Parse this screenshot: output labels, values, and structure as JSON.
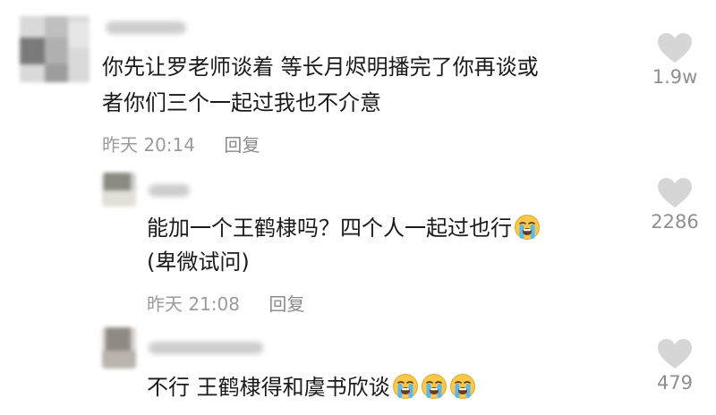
{
  "comments": [
    {
      "lines": [
        "你先让罗老师谈着 等长月烬明播完了你再谈或",
        "者你们三个一起过我也不介意"
      ],
      "time": "昨天 20:14",
      "reply": "回复",
      "likes": "1.9w"
    },
    {
      "lines": [
        "能加一个王鹤棣吗？四个人一起过也行",
        "(卑微试问)"
      ],
      "time": "昨天 21:08",
      "reply": "回复",
      "likes": "2286",
      "emoji": "loudly-crying-face"
    },
    {
      "lines": [
        "不行 王鹤棣得和虞书欣谈"
      ],
      "likes": "479",
      "emoji": "loudly-crying-face",
      "emoji_count": 3
    }
  ],
  "colors": {
    "text": "#1a1a1a",
    "meta": "#9b9b9b",
    "heart": "#d6d6d6"
  }
}
